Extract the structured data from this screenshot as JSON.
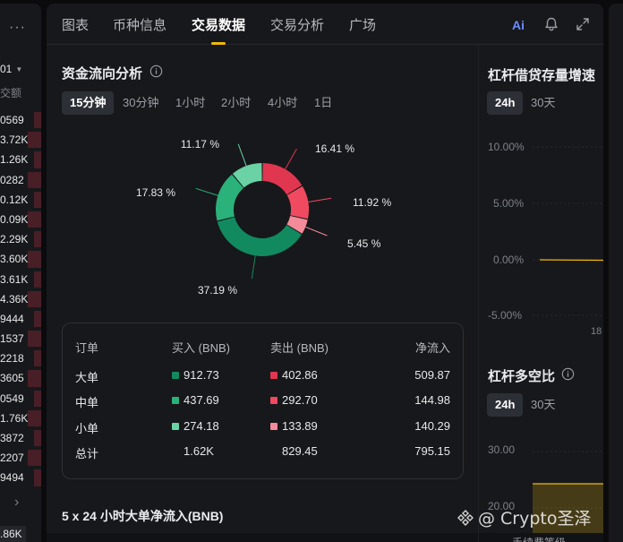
{
  "left_panel": {
    "menu_icon": "ellipsis-icon",
    "header_value": "01",
    "header_label": "交额",
    "values": [
      "0569",
      "3.72K",
      "1.26K",
      "0282",
      "0.12K",
      "0.09K",
      "2.29K",
      "3.60K",
      "3.61K",
      "4.36K",
      "9444",
      "1537",
      "2218",
      "3605",
      "0549",
      "1.76K",
      "3872",
      "2207",
      "9494"
    ],
    "last_value": ".86K"
  },
  "tabs": [
    {
      "label": "图表"
    },
    {
      "label": "币种信息"
    },
    {
      "label": "交易数据"
    },
    {
      "label": "交易分析"
    },
    {
      "label": "广场"
    }
  ],
  "toolbar": {
    "ai_label": "Ai",
    "bell_icon": "bell-icon",
    "expand_icon": "expand-icon"
  },
  "flow": {
    "title": "资金流向分析",
    "periods": [
      "15分钟",
      "30分钟",
      "1小时",
      "2小时",
      "4小时",
      "1日"
    ],
    "active_period": "15分钟"
  },
  "chart_data": {
    "type": "pie",
    "donut": true,
    "categories": [
      "卖出 大单",
      "卖出 中单",
      "卖出 小单",
      "买入 大单",
      "买入 中单",
      "买入 小单"
    ],
    "values": [
      16.41,
      11.92,
      5.45,
      37.19,
      17.83,
      11.17
    ],
    "labels": [
      "16.41 %",
      "11.92 %",
      "5.45 %",
      "37.19 %",
      "17.83 %",
      "11.17 %"
    ],
    "colors": [
      "#e0364f",
      "#ef4a60",
      "#f38b99",
      "#128a60",
      "#2bb17a",
      "#6ad2a4"
    ]
  },
  "table": {
    "headers": [
      "订单",
      "买入 (BNB)",
      "卖出 (BNB)",
      "净流入"
    ],
    "rows": [
      {
        "name": "大单",
        "buy": "912.73",
        "sell": "402.86",
        "net": "509.87",
        "buy_color": "#128a60",
        "sell_color": "#e0364f"
      },
      {
        "name": "中单",
        "buy": "437.69",
        "sell": "292.70",
        "net": "144.98",
        "buy_color": "#2bb17a",
        "sell_color": "#ef4a60"
      },
      {
        "name": "小单",
        "buy": "274.18",
        "sell": "133.89",
        "net": "140.29",
        "buy_color": "#6ad2a4",
        "sell_color": "#f38b99"
      }
    ],
    "total": {
      "name": "总计",
      "buy": "1.62K",
      "sell": "829.45",
      "net": "795.15"
    }
  },
  "bottom_title": "5 x 24 小时大单净流入(BNB)",
  "margin_growth": {
    "title": "杠杆借贷存量增速",
    "periods": [
      "24h",
      "30天"
    ],
    "active_period": "24h",
    "y_ticks": [
      "10.00%",
      "5.00%",
      "0.00%",
      "-5.00%"
    ],
    "x_tick": "18",
    "line_value": 0
  },
  "long_short": {
    "title": "杠杆多空比",
    "periods": [
      "24h",
      "30天"
    ],
    "active_period": "24h",
    "y_ticks": [
      "30.00",
      "20.00"
    ],
    "accent": "#f0b90b"
  },
  "watermark": {
    "text": "@ Crypto圣泽"
  },
  "fee_text": "手续费等级"
}
